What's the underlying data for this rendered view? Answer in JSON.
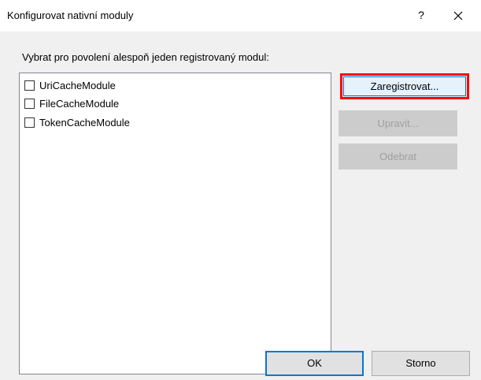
{
  "window": {
    "title": "Konfigurovat nativní moduly",
    "help_label": "?",
    "close_icon": "close-icon"
  },
  "prompt": "Vybrat pro povolení alespoň jeden registrovaný modul:",
  "modules": [
    {
      "label": "UriCacheModule",
      "checked": false
    },
    {
      "label": "FileCacheModule",
      "checked": false
    },
    {
      "label": "TokenCacheModule",
      "checked": false
    }
  ],
  "buttons": {
    "register": "Zaregistrovat...",
    "edit": "Upravit...",
    "remove": "Odebrat",
    "ok": "OK",
    "cancel": "Storno"
  },
  "colors": {
    "highlight_border": "#ff0000",
    "default_button_border": "#0078d7"
  }
}
